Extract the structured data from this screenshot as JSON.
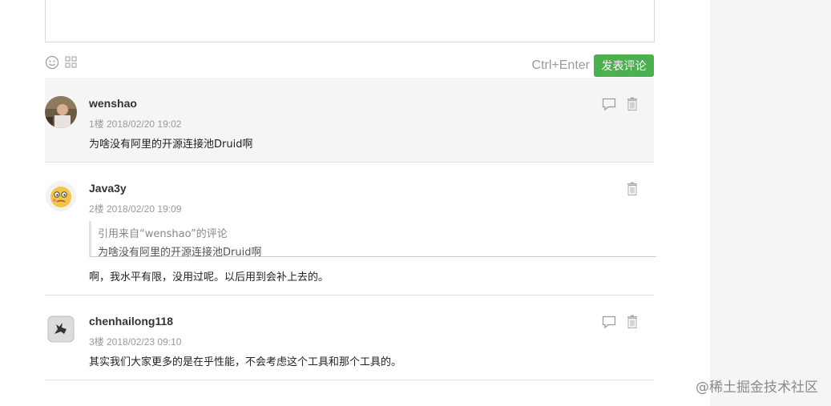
{
  "composer": {
    "shortcut_hint": "Ctrl+Enter",
    "submit_label": "发表评论",
    "emoji_icon": "smiley-icon",
    "image_icon": "grid-icon"
  },
  "comments": [
    {
      "username": "wenshao",
      "floor_time": "1楼 2018/02/20 19:02",
      "text": "为啥没有阿里的开源连接池Druid啊",
      "highlighted": true,
      "actions": [
        "reply-icon",
        "trash-icon"
      ]
    },
    {
      "username": "Java3y",
      "floor_time": "2楼 2018/02/20 19:09",
      "quote_source": "引用来自“wenshao”的评论",
      "quote_text": "为啥没有阿里的开源连接池Druid啊",
      "text": "啊，我水平有限，没用过呢。以后用到会补上去的。",
      "actions": [
        "trash-icon"
      ]
    },
    {
      "username": "chenhailong118",
      "floor_time": "3楼 2018/02/23 09:10",
      "text": "其实我们大家更多的是在乎性能，不会考虑这个工具和那个工具的。",
      "actions": [
        "reply-icon",
        "trash-icon"
      ]
    }
  ],
  "watermark": "@稀土掘金技术社区",
  "colors": {
    "accent": "#4caf50",
    "highlight_bg": "#f5f5f5",
    "side_bg": "#f5f5f5"
  }
}
